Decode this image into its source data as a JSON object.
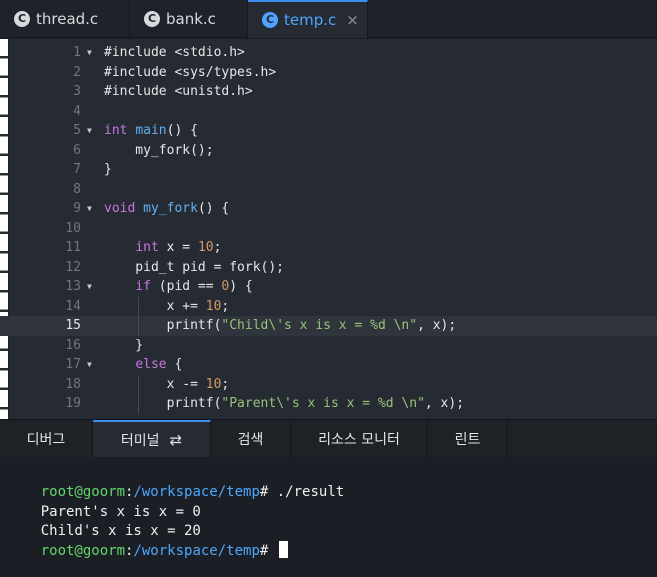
{
  "file_tabs": [
    {
      "label": "thread.c",
      "icon": "c-file-icon"
    },
    {
      "label": "bank.c",
      "icon": "c-file-icon"
    },
    {
      "label": "temp.c",
      "icon": "c-file-icon",
      "active": true,
      "close": "×"
    }
  ],
  "editor": {
    "current_line": 15,
    "lines": [
      {
        "num": "1",
        "fold": true,
        "tokens": [
          [
            "",
            "#include <stdio.h>"
          ]
        ]
      },
      {
        "num": "2",
        "tokens": [
          [
            "",
            "#include <sys/types.h>"
          ]
        ]
      },
      {
        "num": "3",
        "tokens": [
          [
            "",
            "#include <unistd.h>"
          ]
        ]
      },
      {
        "num": "4",
        "tokens": []
      },
      {
        "num": "5",
        "fold": true,
        "tokens": [
          [
            "k",
            "int"
          ],
          [
            "",
            " "
          ],
          [
            "f",
            "main"
          ],
          [
            "",
            "() {"
          ]
        ]
      },
      {
        "num": "6",
        "tokens": [
          [
            "",
            "    my_fork();"
          ]
        ]
      },
      {
        "num": "7",
        "tokens": [
          [
            "",
            "}"
          ]
        ]
      },
      {
        "num": "8",
        "tokens": []
      },
      {
        "num": "9",
        "fold": true,
        "tokens": [
          [
            "k",
            "void"
          ],
          [
            "",
            " "
          ],
          [
            "f",
            "my_fork"
          ],
          [
            "",
            "() {"
          ]
        ]
      },
      {
        "num": "10",
        "tokens": []
      },
      {
        "num": "11",
        "tokens": [
          [
            "",
            "    "
          ],
          [
            "k",
            "int"
          ],
          [
            "",
            " x = "
          ],
          [
            "n",
            "10"
          ],
          [
            "",
            ";"
          ]
        ]
      },
      {
        "num": "12",
        "tokens": [
          [
            "",
            "    pid_t pid = fork();"
          ]
        ]
      },
      {
        "num": "13",
        "fold": true,
        "tokens": [
          [
            "",
            "    "
          ],
          [
            "k",
            "if"
          ],
          [
            "",
            " (pid == "
          ],
          [
            "n",
            "0"
          ],
          [
            "",
            ") {"
          ]
        ]
      },
      {
        "num": "14",
        "tokens": [
          [
            "",
            "        x += "
          ],
          [
            "n",
            "10"
          ],
          [
            "",
            ";"
          ]
        ]
      },
      {
        "num": "15",
        "tokens": [
          [
            "",
            "        printf("
          ],
          [
            "s",
            "\"Child\\'s x is x = %d \\n\""
          ],
          [
            "",
            ", x);"
          ]
        ]
      },
      {
        "num": "16",
        "tokens": [
          [
            "",
            "    }"
          ]
        ]
      },
      {
        "num": "17",
        "fold": true,
        "tokens": [
          [
            "",
            "    "
          ],
          [
            "k",
            "else"
          ],
          [
            "",
            " {"
          ]
        ]
      },
      {
        "num": "18",
        "tokens": [
          [
            "",
            "        x -= "
          ],
          [
            "n",
            "10"
          ],
          [
            "",
            ";"
          ]
        ]
      },
      {
        "num": "19",
        "tokens": [
          [
            "",
            "        printf("
          ],
          [
            "s",
            "\"Parent\\'s x is x = %d \\n\""
          ],
          [
            "",
            ", x);"
          ]
        ]
      }
    ]
  },
  "panel_tabs": [
    {
      "label": "디버그"
    },
    {
      "label": "터미널",
      "active": true,
      "icon": "refresh-icon"
    },
    {
      "label": "검색"
    },
    {
      "label": "리소스 모니터"
    },
    {
      "label": "린트"
    }
  ],
  "terminal": {
    "lines": [
      {
        "user": "root@goorm",
        "sep": ":",
        "path": "/workspace/temp",
        "prompt": "#",
        "cmd": " ./result"
      },
      {
        "text": "Parent's x is x = 0"
      },
      {
        "text": "Child's x is x = 20"
      },
      {
        "user": "root@goorm",
        "sep": ":",
        "path": "/workspace/temp",
        "prompt": "#",
        "cmd": " ",
        "cursor": true
      }
    ]
  },
  "colors": {
    "keyword": "#c678dd",
    "function": "#61afef",
    "string": "#98c379",
    "number": "#d19a66",
    "accent": "#3d8ef0",
    "terminal_user": "#62d86a",
    "terminal_path": "#4aa8ff"
  }
}
